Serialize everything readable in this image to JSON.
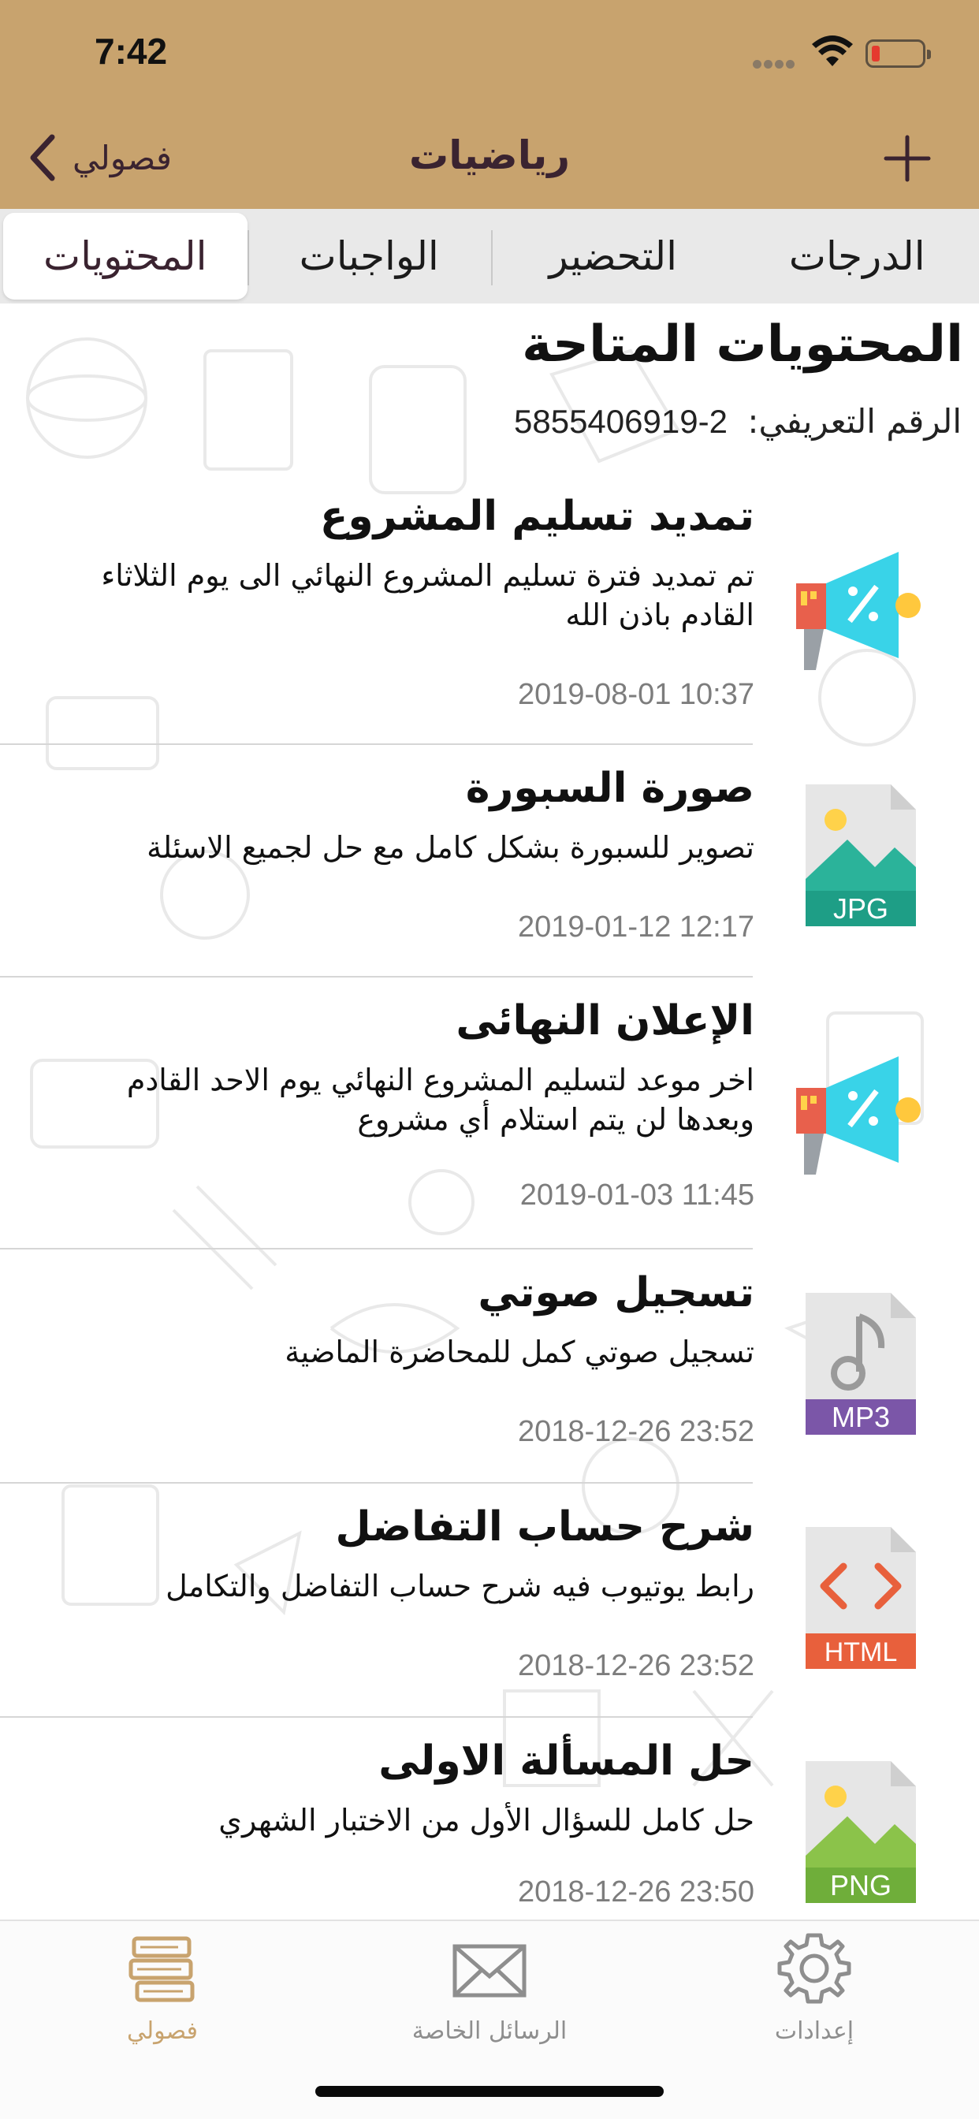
{
  "status_bar": {
    "time": "7:42"
  },
  "nav": {
    "back_label": "فصولي",
    "title": "رياضيات",
    "add_icon": "plus-icon"
  },
  "tabs": [
    {
      "label": "الدرجات",
      "active": false
    },
    {
      "label": "التحضير",
      "active": false
    },
    {
      "label": "الواجبات",
      "active": false
    },
    {
      "label": "المحتويات",
      "active": true
    }
  ],
  "content": {
    "section_title": "المحتويات المتاحة",
    "id_label": "الرقم التعريفي:",
    "id_value": "2-5855406919"
  },
  "items": [
    {
      "title": "تمديد تسليم المشروع",
      "description": "تم تمديد فترة تسليم المشروع النهائي الى يوم الثلاثاء القادم باذن الله",
      "date": "2019-08-01 10:37",
      "icon": "megaphone-icon"
    },
    {
      "title": "صورة السبورة",
      "description": "تصوير للسبورة بشكل كامل مع حل لجميع الاسئلة",
      "date": "2019-01-12 12:17",
      "icon": "jpg-file-icon",
      "file_label": "JPG"
    },
    {
      "title": "الإعلان النهائى",
      "description": "اخر موعد لتسليم المشروع النهائي يوم الاحد القادم وبعدها لن يتم استلام أي مشروع",
      "date": "2019-01-03 11:45",
      "icon": "megaphone-icon"
    },
    {
      "title": "تسجيل صوتي",
      "description": "تسجيل صوتي كمل للمحاضرة الماضية",
      "date": "2018-12-26 23:52",
      "icon": "mp3-file-icon",
      "file_label": "MP3"
    },
    {
      "title": "شرح حساب التفاضل",
      "description": "رابط يوتيوب فيه شرح حساب التفاضل والتكامل",
      "date": "2018-12-26 23:52",
      "icon": "html-file-icon",
      "file_label": "HTML"
    },
    {
      "title": "حل المسألة الاولى",
      "description": "حل كامل للسؤال الأول من الاختبار الشهري",
      "date": "2018-12-26 23:50",
      "icon": "png-file-icon",
      "file_label": "PNG"
    }
  ],
  "tabbar": [
    {
      "label": "إعدادات",
      "icon": "gear-icon",
      "active": false
    },
    {
      "label": "الرسائل الخاصة",
      "icon": "envelope-icon",
      "active": false
    },
    {
      "label": "فصولي",
      "icon": "books-icon",
      "active": true
    }
  ],
  "colors": {
    "header_bg": "#c8a36e",
    "title_text": "#3a2330",
    "active_tab_tint": "#c8a36e",
    "inactive_tab_tint": "#8e8e8e"
  }
}
